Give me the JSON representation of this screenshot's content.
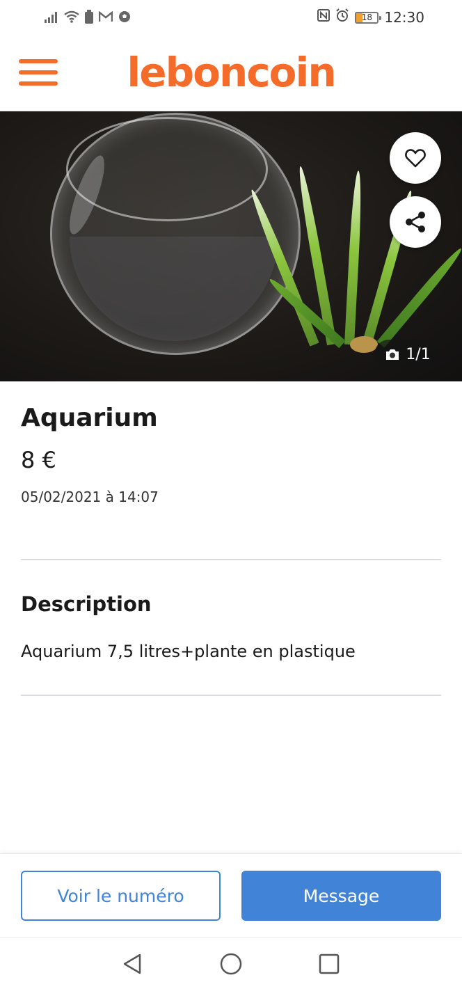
{
  "status_bar": {
    "time": "12:30",
    "battery_level": "18",
    "left_icons": [
      "signal-icon",
      "wifi-icon",
      "battery-saver-icon",
      "gmail-icon",
      "football-icon"
    ],
    "right_icons": [
      "nfc-icon",
      "alarm-icon",
      "battery-icon"
    ]
  },
  "header": {
    "logo_text": "leboncoin",
    "menu_icon": "hamburger-menu-icon"
  },
  "colors": {
    "brand": "#f56b2a",
    "primary_blue": "#4183d7",
    "divider": "#d8dce2"
  },
  "gallery": {
    "counter": "1/1",
    "favorite_icon": "heart-icon",
    "share_icon": "share-icon",
    "camera_icon": "camera-icon"
  },
  "ad": {
    "title": "Aquarium",
    "price": "8 €",
    "date": "05/02/2021 à 14:07"
  },
  "description": {
    "heading": "Description",
    "text": "Aquarium 7,5 litres+plante en plastique"
  },
  "actions": {
    "phone_label": "Voir le numéro",
    "message_label": "Message"
  },
  "navigation": {
    "back_icon": "back-triangle-icon",
    "home_icon": "home-circle-icon",
    "recents_icon": "recents-square-icon"
  }
}
